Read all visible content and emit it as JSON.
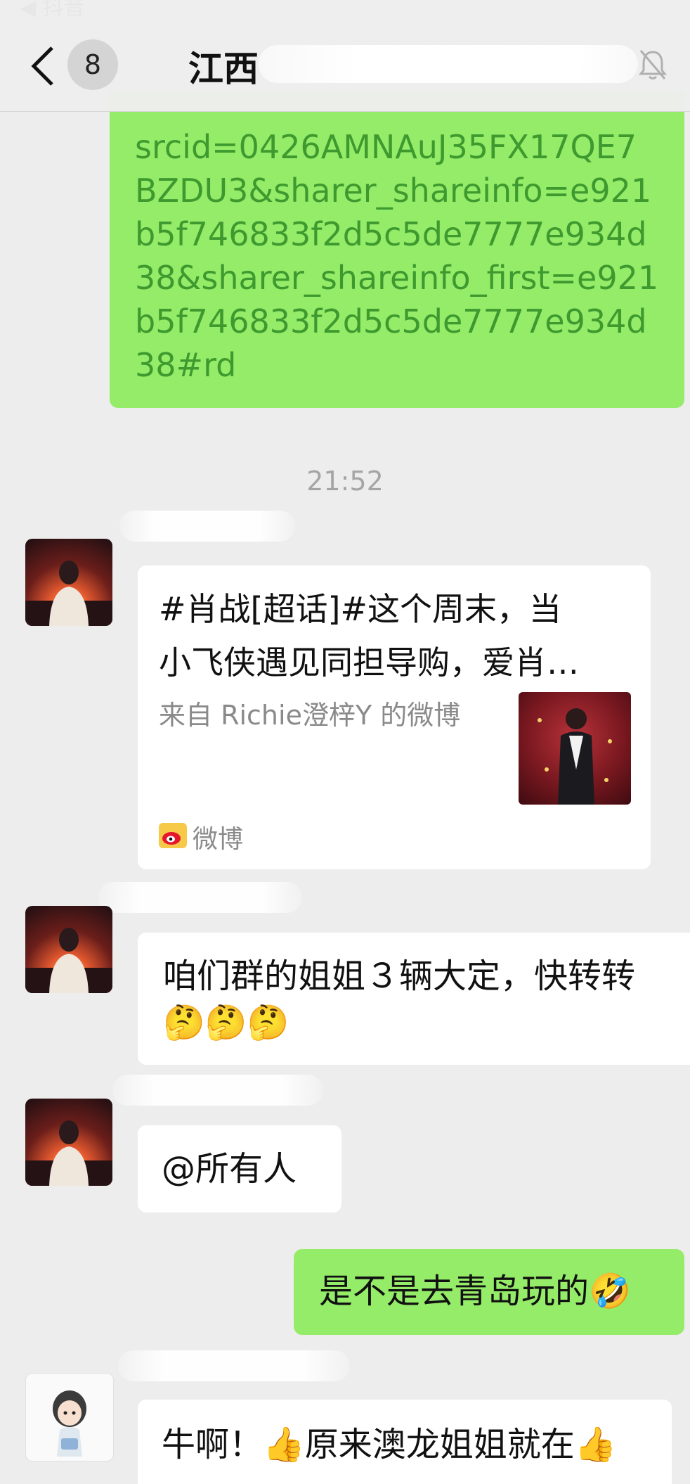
{
  "status": {
    "return_app": "抖音"
  },
  "header": {
    "back_icon": "chevron-left-icon",
    "unread_count": "8",
    "title": "江西",
    "mute_icon": "bell-muted-icon"
  },
  "messages": [
    {
      "type": "link",
      "sender": "me",
      "text": "srcid=0426AMNAuJ35FX17QE7\nBZDU3&sharer_shareinfo=e921\nb5f746833f2d5c5de7777e934d\n38&sharer_shareinfo_first=e921\nb5f746833f2d5c5de7777e934d\n38#rd"
    },
    {
      "type": "time",
      "text": "21:52"
    },
    {
      "type": "card",
      "sender": "other",
      "title_line1": "#肖战[超话]#这个周末，当",
      "title_line2": "小飞侠遇见同担导购，爱肖…",
      "source": "来自 Richie澄梓Y 的微博",
      "app_label": "微博",
      "app_icon": "weibo-icon"
    },
    {
      "type": "text",
      "sender": "other",
      "line1": "咱们群的姐姐３辆大定，快转转",
      "line2": "🤔🤔🤔"
    },
    {
      "type": "text",
      "sender": "other",
      "text": "@所有人"
    },
    {
      "type": "text",
      "sender": "me",
      "text": "是不是去青岛玩的🤣"
    },
    {
      "type": "text",
      "sender": "other",
      "text": "牛啊！👍原来澳龙姐姐就在👍"
    }
  ],
  "colors": {
    "green_bubble": "#95ec69",
    "link_text": "#3e9a2f",
    "background": "#ededed"
  }
}
